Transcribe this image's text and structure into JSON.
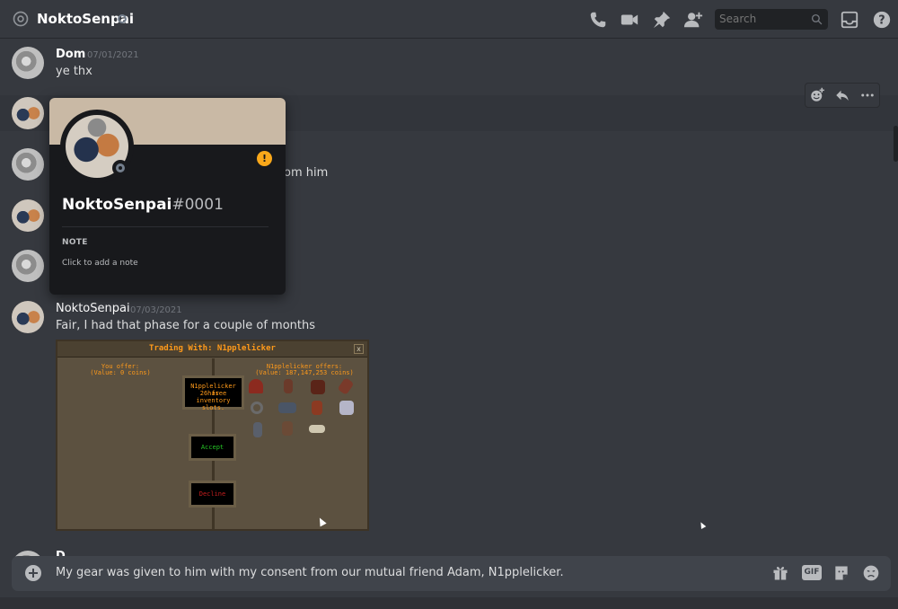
{
  "header": {
    "channel_name": "NoktoSenpai",
    "search_placeholder": "Search"
  },
  "messages": [
    {
      "author": "Dom",
      "timestamp": "07/01/2021",
      "text": "ye thx"
    },
    {
      "fragment_text": "om him"
    },
    {
      "author": "NoktoSenpai",
      "timestamp": "07/03/2021",
      "text": "Fair, I had that phase for a couple of months"
    }
  ],
  "partial_author": "D",
  "attachment": {
    "title": "Trading With: N1pplelicker",
    "close_glyph": "x",
    "you_offer": "You offer:",
    "you_value": "(Value: 0 coins)",
    "other_offers": "N1pplelicker offers:",
    "other_value": "(Value: 187,147,253 coins)",
    "slots_notice": [
      "N1pplelicker has",
      "26 free",
      "inventory slots."
    ],
    "accept_label": "Accept",
    "decline_label": "Decline"
  },
  "profile_popout": {
    "username": "NoktoSenpai",
    "discriminator": "#0001",
    "warning_glyph": "!",
    "note_label": "NOTE",
    "note_placeholder": "Click to add a note"
  },
  "composer": {
    "text": "My gear was given to him with my consent from our mutual friend Adam, N1pplelicker.",
    "gif_label": "GIF"
  },
  "icons": [
    "at-icon",
    "phone-icon",
    "video-icon",
    "pin-icon",
    "add-friend-icon",
    "search-icon",
    "inbox-icon",
    "help-icon",
    "add-reaction-icon",
    "reply-icon",
    "more-icon",
    "gift-icon",
    "sticker-icon",
    "emoji-icon"
  ],
  "colors": {
    "background": "#36393f",
    "popout": "#18191c",
    "banner": "#c9b9a5",
    "warning": "#faa81a",
    "offline": "#747f8d"
  }
}
